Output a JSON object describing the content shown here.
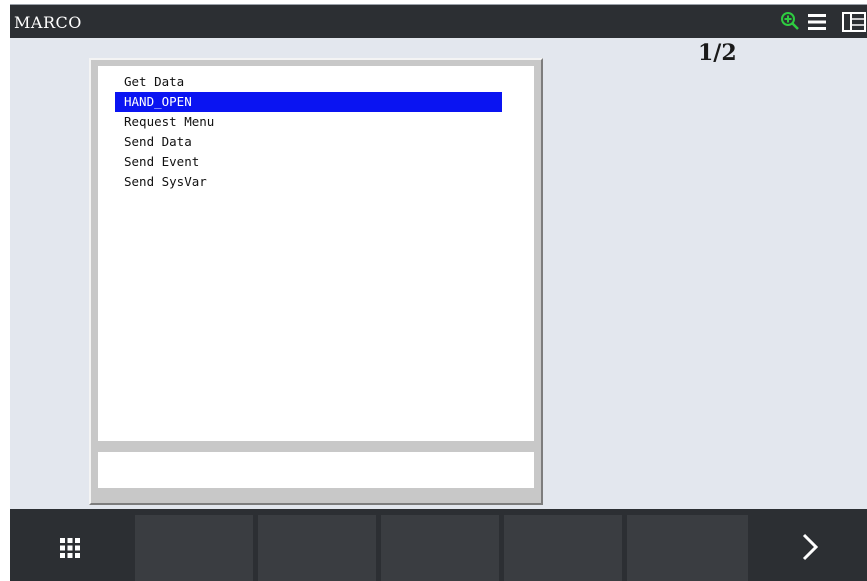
{
  "titlebar": {
    "title": "MARCO",
    "icons": [
      "zoom-in-icon",
      "menu-icon",
      "split-view-icon"
    ],
    "zoom_color": "#2ecc40"
  },
  "page_indicator": "1/2",
  "menu": {
    "items": [
      {
        "label": "Get Data",
        "selected": false
      },
      {
        "label": "HAND_OPEN",
        "selected": true
      },
      {
        "label": "Request Menu",
        "selected": false
      },
      {
        "label": "Send Data",
        "selected": false
      },
      {
        "label": "Send Event",
        "selected": false
      },
      {
        "label": "Send SysVar",
        "selected": false
      }
    ],
    "selection_color": "#0a14f2",
    "input_value": ""
  },
  "bottom_bar": {
    "left_icon": "grid-apps-icon",
    "right_icon": "chevron-right-icon",
    "function_keys": [
      "",
      "",
      "",
      "",
      ""
    ]
  }
}
